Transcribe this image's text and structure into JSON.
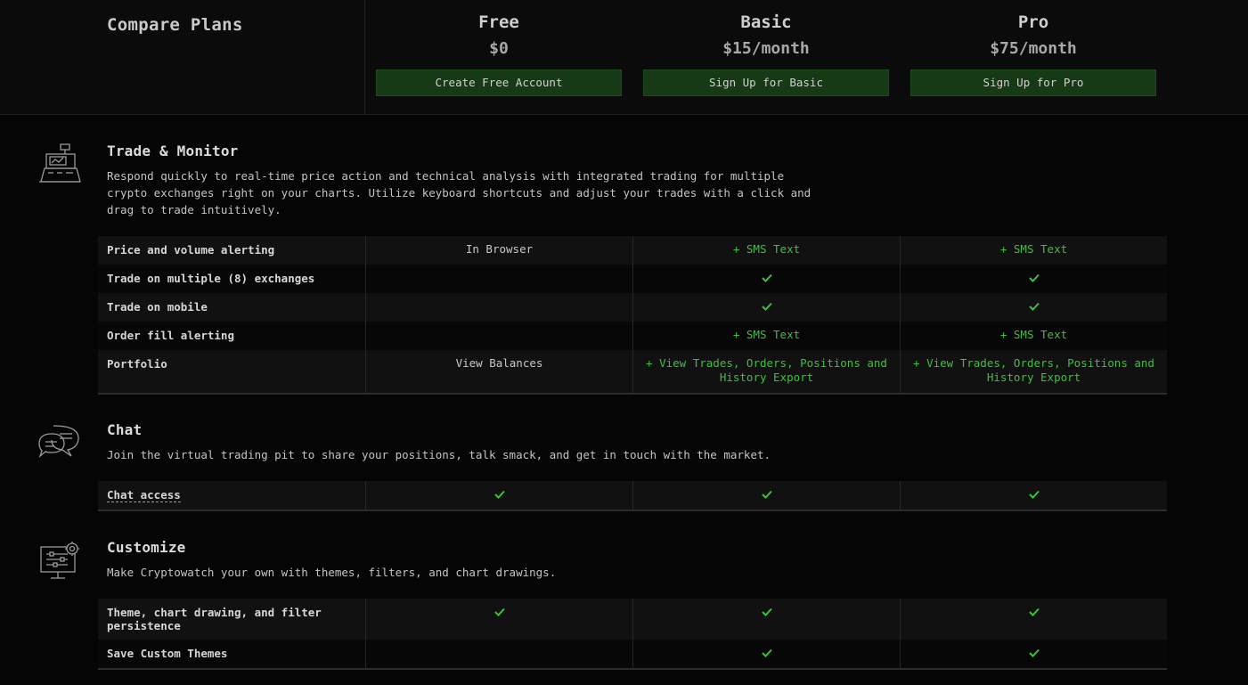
{
  "header": {
    "title": "Compare Plans",
    "plans": [
      {
        "name": "Free",
        "price": "$0",
        "cta": "Create Free Account"
      },
      {
        "name": "Basic",
        "price": "$15/month",
        "cta": "Sign Up for Basic"
      },
      {
        "name": "Pro",
        "price": "$75/month",
        "cta": "Sign Up for Pro"
      }
    ]
  },
  "colors": {
    "accent_green": "#3ec03e",
    "button_green": "#163a16",
    "background": "#050505"
  },
  "sections": [
    {
      "icon": "cash-register-icon",
      "title": "Trade & Monitor",
      "description": "Respond quickly to real-time price action and technical analysis with integrated trading for multiple crypto exchanges right on your charts. Utilize keyboard shortcuts and adjust your trades with a click and drag to trade intuitively.",
      "rows": [
        {
          "feature": "Price and volume alerting",
          "free": "In Browser",
          "basic": "+ SMS Text",
          "pro": "+ SMS Text"
        },
        {
          "feature": "Trade on multiple (8) exchanges",
          "free": "",
          "basic": "check",
          "pro": "check"
        },
        {
          "feature": "Trade on mobile",
          "free": "",
          "basic": "check",
          "pro": "check"
        },
        {
          "feature": "Order fill alerting",
          "free": "",
          "basic": "+ SMS Text",
          "pro": "+ SMS Text"
        },
        {
          "feature": "Portfolio",
          "free": "View Balances",
          "basic": "+ View Trades, Orders, Positions and History Export",
          "pro": "+ View Trades, Orders, Positions and History Export"
        }
      ]
    },
    {
      "icon": "chat-bubbles-icon",
      "title": "Chat",
      "description": "Join the virtual trading pit to share your positions, talk smack, and get in touch with the market.",
      "rows": [
        {
          "feature": "Chat access",
          "free": "check",
          "basic": "check",
          "pro": "check"
        }
      ]
    },
    {
      "icon": "monitor-settings-icon",
      "title": "Customize",
      "description": "Make Cryptowatch your own with themes, filters, and chart drawings.",
      "rows": [
        {
          "feature": "Theme, chart drawing, and filter persistence",
          "free": "check",
          "basic": "check",
          "pro": "check"
        },
        {
          "feature": "Save Custom Themes",
          "free": "",
          "basic": "check",
          "pro": "check"
        }
      ]
    }
  ]
}
